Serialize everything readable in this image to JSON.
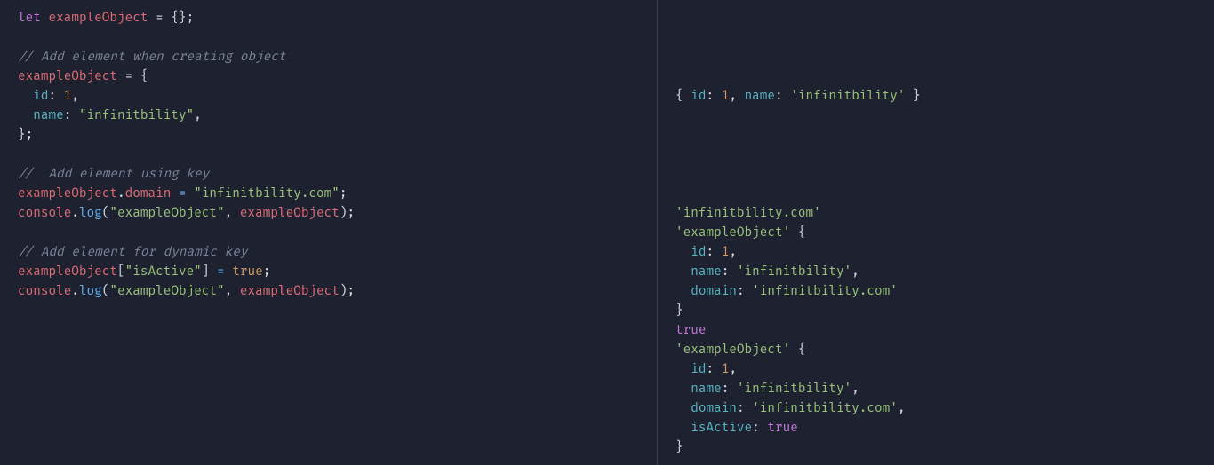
{
  "editor": {
    "t_let": "let",
    "t_ident": "exampleObject",
    "t_assign_empty": " = {};",
    "c_create": "// Add element when creating object",
    "t_assign_open": " = {",
    "p_id": "id",
    "v_id": "1",
    "p_name": "name",
    "v_name": "\"infinitbility\"",
    "t_close_obj": "};",
    "c_key": "//  Add element using key",
    "t_dot": ".",
    "p_domain": "domain",
    "t_eq_space": " = ",
    "v_domain": "\"infinitbility.com\"",
    "t_semi": ";",
    "t_console": "console",
    "t_log": "log",
    "t_open_paren": "(",
    "t_close_paren": ")",
    "t_str_arg": "\"exampleObject\"",
    "t_comma_sp": ", ",
    "c_dyn": "// Add element for dynamic key",
    "t_lbrack": "[",
    "t_rbrack": "]",
    "t_str_isactive": "\"isActive\"",
    "t_true": "true"
  },
  "output": {
    "l1_a": "{ ",
    "l1_id": "id",
    "l1_colon": ": ",
    "l1_idv": "1",
    "l1_comma": ", ",
    "l1_name": "name",
    "l1_namev": "'infinitbility'",
    "l1_z": " }",
    "blk1_domain_str": "'infinitbility.com'",
    "blk1_label": "'exampleObject'",
    "blk1_open": " {",
    "blk1_indent": "  ",
    "blk1_id": "id",
    "blk1_colon": ": ",
    "blk1_idv": "1",
    "blk1_comma": ",",
    "blk1_name": "name",
    "blk1_namev": "'infinitbility'",
    "blk1_domain": "domain",
    "blk1_domainv": "'infinitbility.com'",
    "blk1_close": "}",
    "true_line": "true",
    "blk2_isactive": "isActive",
    "blk2_isactivev": "true"
  }
}
